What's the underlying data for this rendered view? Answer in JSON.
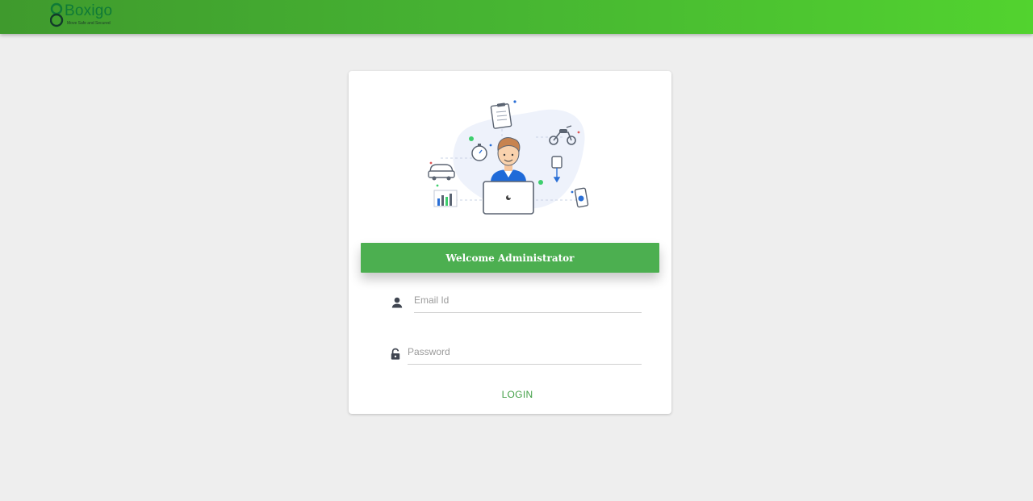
{
  "header": {
    "logo_text": "Boxigo",
    "logo_tagline": "Move Safe and Secured"
  },
  "card": {
    "welcome_text": "Welcome Administrator",
    "email": {
      "placeholder": "Email Id",
      "value": ""
    },
    "password": {
      "placeholder": "Password",
      "value": ""
    },
    "login_label": "LOGIN"
  },
  "icons": {
    "user": "user-icon",
    "lock": "lock-icon"
  },
  "colors": {
    "header_start": "#3f9a2d",
    "header_end": "#52d32f",
    "primary_green": "#4caf50",
    "background": "#eeeeee",
    "logo_text": "#0f7a37"
  }
}
